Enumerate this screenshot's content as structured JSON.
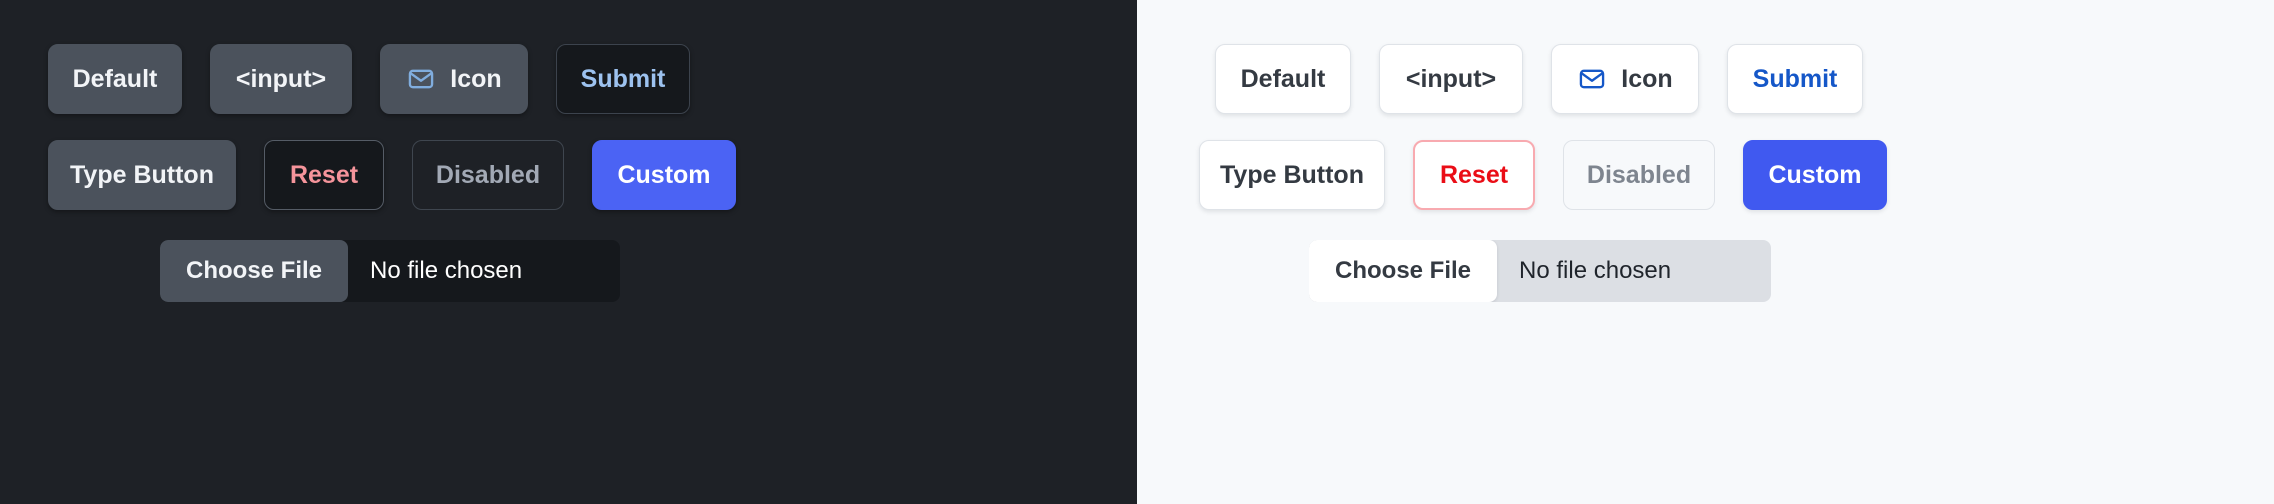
{
  "panels": [
    {
      "theme": "dark",
      "background": "#1e2126",
      "rows": [
        {
          "buttons": [
            {
              "label": "Default",
              "variant": "default"
            },
            {
              "label": "<input>",
              "variant": "input"
            },
            {
              "label": "Icon",
              "variant": "icon",
              "icon": "envelope-icon"
            },
            {
              "label": "Submit",
              "variant": "submit"
            }
          ]
        },
        {
          "buttons": [
            {
              "label": "Type Button",
              "variant": "type"
            },
            {
              "label": "Reset",
              "variant": "reset"
            },
            {
              "label": "Disabled",
              "variant": "disabled"
            },
            {
              "label": "Custom",
              "variant": "custom"
            }
          ]
        }
      ],
      "file_input": {
        "button_label": "Choose File",
        "status_text": "No file chosen"
      },
      "colors": {
        "button_bg": "#4b525c",
        "button_text": "#f2f4f7",
        "submit_text": "#9dc2ef",
        "reset_text": "#f5949b",
        "disabled_text": "#a2a9b5",
        "custom_bg": "#4b63f4",
        "custom_text": "#ffffff",
        "icon_stroke": "#80adde",
        "surface_sunken": "#15181c"
      }
    },
    {
      "theme": "light",
      "background": "#f7f9fb",
      "rows": [
        {
          "buttons": [
            {
              "label": "Default",
              "variant": "default"
            },
            {
              "label": "<input>",
              "variant": "input"
            },
            {
              "label": "Icon",
              "variant": "icon",
              "icon": "envelope-icon"
            },
            {
              "label": "Submit",
              "variant": "submit"
            }
          ]
        },
        {
          "buttons": [
            {
              "label": "Type Button",
              "variant": "type"
            },
            {
              "label": "Reset",
              "variant": "reset"
            },
            {
              "label": "Disabled",
              "variant": "disabled"
            },
            {
              "label": "Custom",
              "variant": "custom"
            }
          ]
        }
      ],
      "file_input": {
        "button_label": "Choose File",
        "status_text": "No file chosen"
      },
      "colors": {
        "button_bg": "#ffffff",
        "button_text": "#343a42",
        "submit_text": "#1557c8",
        "reset_text": "#ea0d16",
        "reset_border": "#f8aab0",
        "disabled_text": "#7e858f",
        "custom_bg": "#4059f0",
        "custom_text": "#ffffff",
        "icon_stroke": "#1557c8",
        "border": "#dfe3e8",
        "file_track": "#dcdfe4"
      }
    }
  ]
}
